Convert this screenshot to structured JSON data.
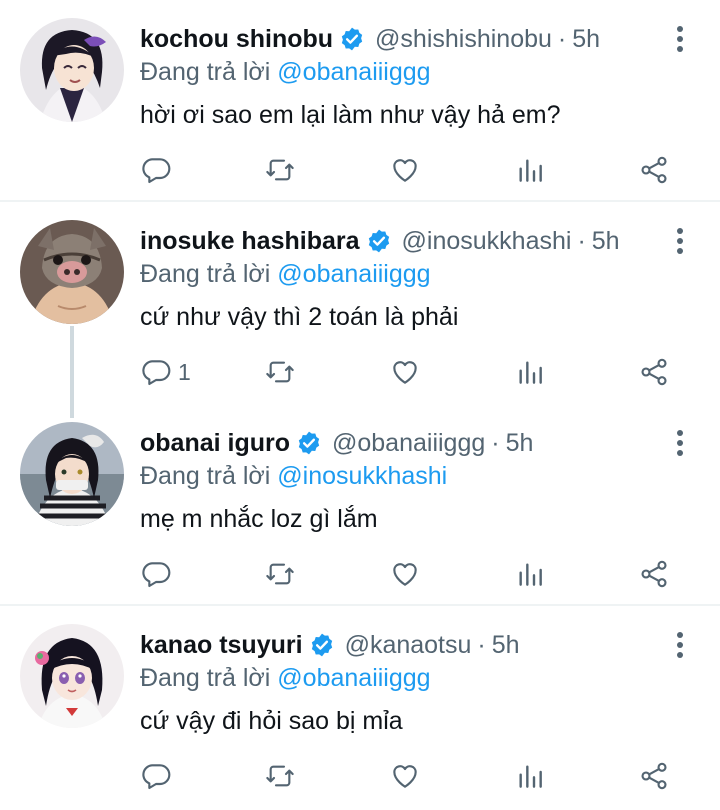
{
  "tweets": [
    {
      "name": "kochou shinobu",
      "handle": "@shishishinobu",
      "dot": "·",
      "time": "5h",
      "reply_prefix": "Đang trả lời",
      "reply_to": "@obanaiiiggg",
      "text": "hời ơi sao em lại làm như vậy hả em?",
      "reply_count": ""
    },
    {
      "name": "inosuke hashibara",
      "handle": "@inosukkhashi",
      "dot": "·",
      "time": "5h",
      "reply_prefix": "Đang trả lời",
      "reply_to": "@obanaiiiggg",
      "text": "cứ như vậy thì 2 toán là phải",
      "reply_count": "1"
    },
    {
      "name": "obanai iguro",
      "handle": "@obanaiiiggg",
      "dot": "·",
      "time": "5h",
      "reply_prefix": "Đang trả lời",
      "reply_to": "@inosukkhashi",
      "text": "mẹ m nhắc loz gì lắm",
      "reply_count": ""
    },
    {
      "name": "kanao tsuyuri",
      "handle": "@kanaotsu",
      "dot": "·",
      "time": "5h",
      "reply_prefix": "Đang trả lời",
      "reply_to": "@obanaiiiggg",
      "text": "cứ vậy đi hỏi sao bị mỉa",
      "reply_count": ""
    }
  ],
  "colors": {
    "accent": "#1d9bf0",
    "muted": "#536471",
    "text": "#0f1419",
    "separator": "#eff3f4",
    "thread_line": "#cfd9de"
  },
  "icons": [
    "reply-icon",
    "retweet-icon",
    "like-icon",
    "analytics-icon",
    "share-icon",
    "verified-badge-icon",
    "more-options-icon"
  ]
}
